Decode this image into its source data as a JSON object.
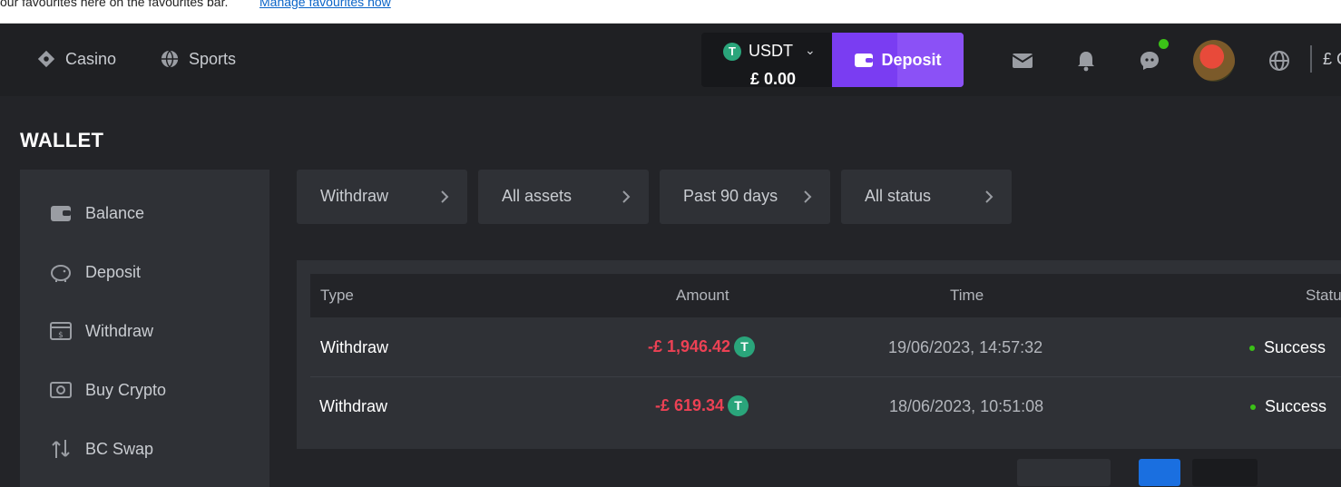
{
  "favourites_bar": {
    "message": "our favourites here on the favourites bar.",
    "link": "Manage favourites now"
  },
  "nav": {
    "casino": "Casino",
    "sports": "Sports",
    "currency": "USDT",
    "balance": "£ 0.00",
    "deposit_label": "Deposit",
    "currency_right": "£ C"
  },
  "wallet": {
    "title": "WALLET",
    "sidebar": [
      {
        "label": "Balance",
        "icon": "wallet-icon"
      },
      {
        "label": "Deposit",
        "icon": "piggy-bank-icon"
      },
      {
        "label": "Withdraw",
        "icon": "withdraw-icon"
      },
      {
        "label": "Buy Crypto",
        "icon": "cash-icon"
      },
      {
        "label": "BC Swap",
        "icon": "swap-icon"
      }
    ],
    "filters": [
      "Withdraw",
      "All assets",
      "Past 90 days",
      "All status"
    ],
    "columns": [
      "Type",
      "Amount",
      "Time",
      "Statu"
    ],
    "rows": [
      {
        "type": "Withdraw",
        "amount": "-£ 1,946.42",
        "time": "19/06/2023, 14:57:32",
        "status": "Success"
      },
      {
        "type": "Withdraw",
        "amount": "-£ 619.34",
        "time": "18/06/2023, 10:51:08",
        "status": "Success"
      }
    ]
  },
  "colors": {
    "accent": "#7a3df2",
    "negative": "#ec4154",
    "success": "#3bc117",
    "tether": "#2aa57b"
  }
}
